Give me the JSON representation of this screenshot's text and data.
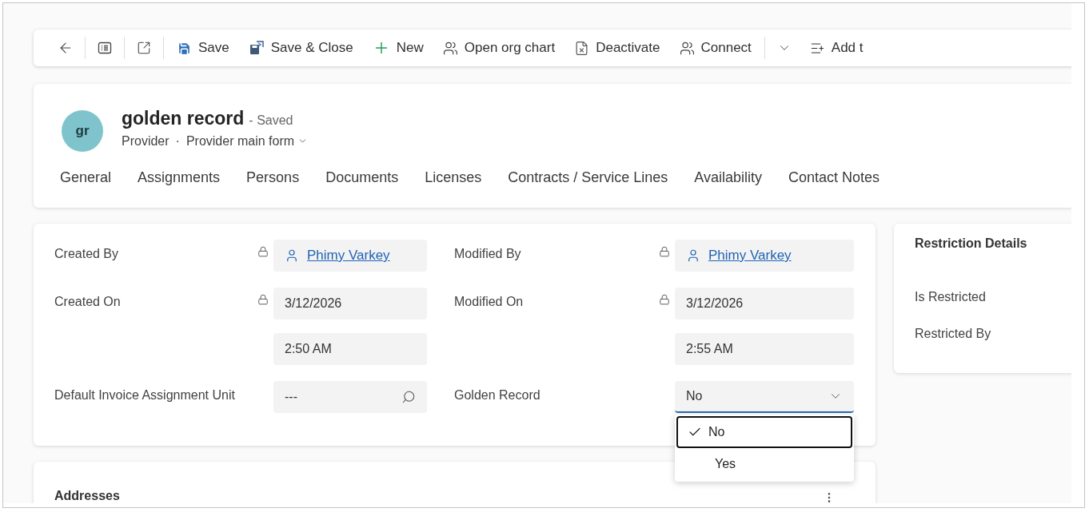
{
  "toolbar": {
    "actions": [
      "Save",
      "Save & Close",
      "New",
      "Open org chart",
      "Deactivate",
      "Connect"
    ],
    "overflow_action": "Add t"
  },
  "header": {
    "initials": "gr",
    "title": "golden record",
    "status": "- Saved",
    "entity": "Provider",
    "separator": "·",
    "form": "Provider main form"
  },
  "tabs": [
    "General",
    "Assignments",
    "Persons",
    "Documents",
    "Licenses",
    "Contracts / Service Lines",
    "Availability",
    "Contact Notes"
  ],
  "form_columns": [
    [
      {
        "label": "Created By",
        "locked": true,
        "kind": "lookup",
        "value": "Phimy Varkey"
      },
      {
        "label": "Created On",
        "locked": true,
        "kind": "datetime",
        "value": "3/12/2026",
        "time": "2:50 AM"
      },
      {
        "label": "Default Invoice Assignment Unit",
        "locked": false,
        "kind": "search",
        "value": "---"
      }
    ],
    [
      {
        "label": "Modified By",
        "locked": true,
        "kind": "lookup",
        "value": "Phimy Varkey"
      },
      {
        "label": "Modified On",
        "locked": true,
        "kind": "datetime",
        "value": "3/12/2026",
        "time": "2:55 AM"
      },
      {
        "label": "Golden Record",
        "locked": false,
        "kind": "select",
        "value": "No",
        "open": true,
        "options": [
          {
            "label": "No",
            "selected": true
          },
          {
            "label": "Yes",
            "selected": false
          }
        ]
      }
    ]
  ],
  "restriction": {
    "title": "Restriction Details",
    "labels": [
      "Is Restricted",
      "Restricted By"
    ]
  },
  "addresses": {
    "title": "Addresses"
  }
}
